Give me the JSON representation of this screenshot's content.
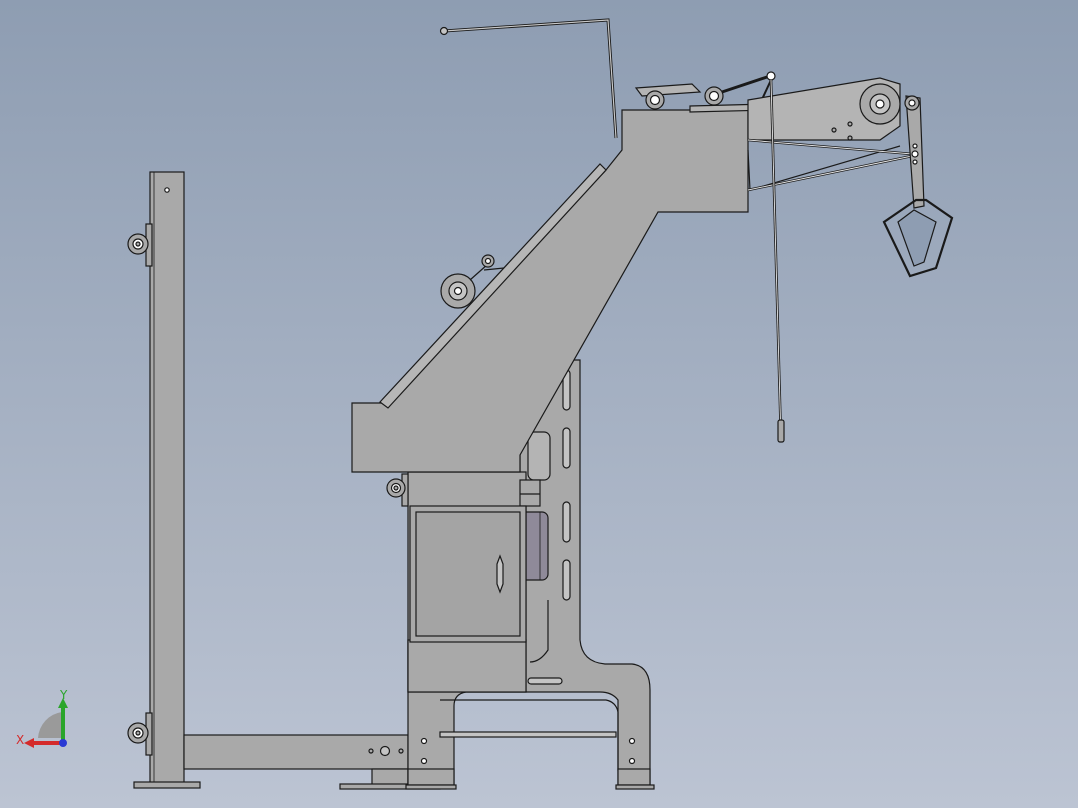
{
  "scene": {
    "background_top": "#8e9db2",
    "background_bottom": "#bcc4d3",
    "part_fill": "#a9a9a9",
    "part_stroke": "#1a1a1a",
    "highlight_fill": "#c4c4c4"
  },
  "triad": {
    "x_label": "X",
    "y_label": "Y",
    "x_color": "#d42a2a",
    "y_color": "#2aa52a",
    "z_color": "#2a3ad4"
  }
}
